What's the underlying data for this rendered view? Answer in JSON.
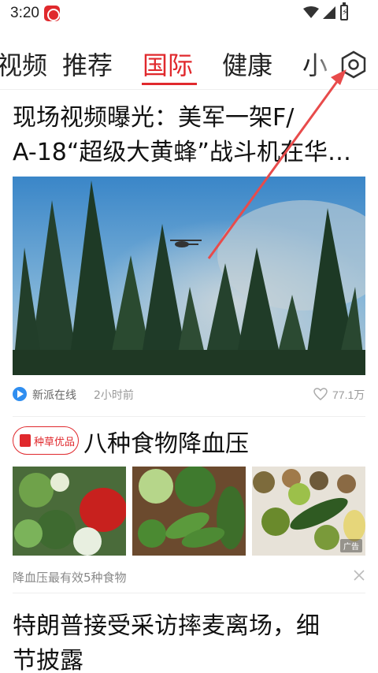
{
  "status_bar": {
    "time": "3:20"
  },
  "tabs": [
    {
      "label": "视频",
      "active": false
    },
    {
      "label": "推荐",
      "active": false
    },
    {
      "label": "国际",
      "active": true
    },
    {
      "label": "健康",
      "active": false
    },
    {
      "label": "小",
      "active": false
    }
  ],
  "settings": {
    "icon": "hexagon-settings-icon"
  },
  "article1": {
    "title_line1": "现场视频曝光：美军一架F/",
    "title_line2": "A-18“超级大黄蜂”战斗机在华…",
    "source": "新派在线",
    "time": "2小时前",
    "likes": "77.1万"
  },
  "ad": {
    "badge": "种草优品",
    "title": "八种食物降血压",
    "tag": "广告",
    "description": "降血压最有效5种食物"
  },
  "article2": {
    "title_line1": "特朗普接受采访摔麦离场，细",
    "title_line2": "节披露"
  },
  "colors": {
    "accent": "#e0292d",
    "annotation_arrow": "#e84b4b"
  }
}
